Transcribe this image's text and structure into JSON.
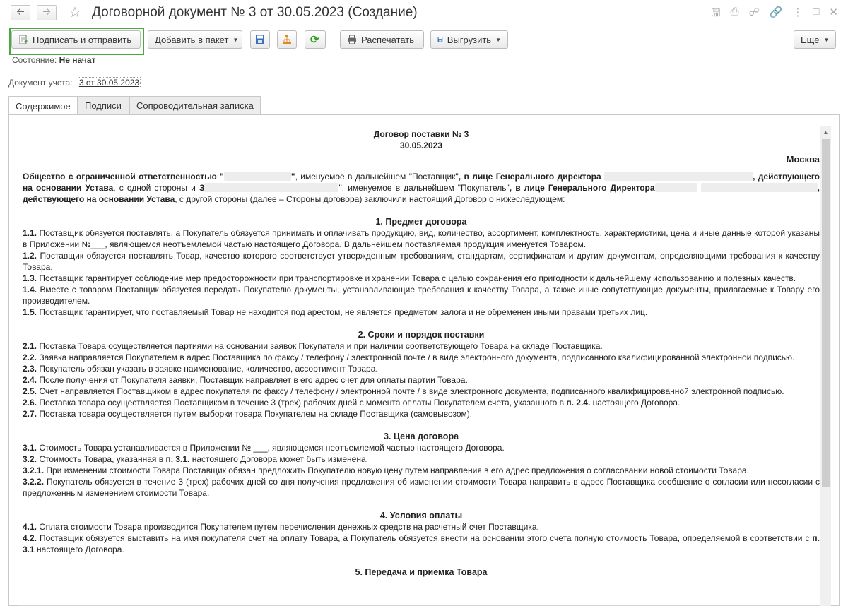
{
  "window": {
    "title": "Договорной документ № 3 от 30.05.2023 (Создание)"
  },
  "toolbar": {
    "sign_send": "Подписать и отправить",
    "add_package": "Добавить в пакет",
    "print": "Распечатать",
    "export": "Выгрузить",
    "more": "Еще"
  },
  "state": {
    "label": "Состояние:",
    "value": "Не начат"
  },
  "account": {
    "label": "Документ учета:",
    "value": "3 от 30.05.2023"
  },
  "tabs": [
    "Содержимое",
    "Подписи",
    "Сопроводительная записка"
  ],
  "document": {
    "title": "Договор поставки № 3",
    "date": "30.05.2023",
    "city": "Москва",
    "intro": {
      "p1": "Общество с ограниченной ответственностью \"",
      "p2": "\"",
      "p3": ", именуемое в дальнейшем \"Поставщик\"",
      "p4": ", в лице Генерального директора",
      "p5": ",",
      "p6": "действующего на основании Устава",
      "p7": ", с одной стороны и ",
      "p8": "З",
      "p9": "\", именуемое в дальнейшем \"Покупатель\"",
      "p10": ", в лице Генерального Директора",
      "p11": ", действующего на основании Устава",
      "p12": ", с другой стороны (далее – Стороны договора) заключили настоящий Договор о нижеследующем:"
    },
    "s1": {
      "title": "1. Предмет договора",
      "n1": "1.1.",
      "t1": " Поставщик обязуется поставлять, а Покупатель обязуется принимать и оплачивать продукцию, вид, количество, ассортимент, комплектность, характеристики, цена и иные данные которой указаны в Приложении №___, являющемся неотъемлемой частью настоящего Договора. В дальнейшем поставляемая продукция именуется Товаром.",
      "n2": "1.2.",
      "t2": " Поставщик обязуется поставлять Товар, качество которого соответствует утвержденным требованиям, стандартам, сертификатам и другим документам, определяющими требования к качеству Товара.",
      "n3": "1.3.",
      "t3": " Поставщик гарантирует соблюдение мер предосторожности при транспортировке и хранении Товара с целью сохранения его пригодности к дальнейшему использованию и полезных качеств.",
      "n4": "1.4.",
      "t4": " Вместе с товаром Поставщик обязуется передать Покупателю документы, устанавливающие требования к качеству Товара, а также иные сопутствующие документы, прилагаемые к Товару его производителем.",
      "n5": "1.5.",
      "t5": " Поставщик гарантирует, что поставляемый Товар не находится под арестом, не является предметом залога и не обременен иными правами третьих лиц."
    },
    "s2": {
      "title": "2. Сроки и порядок поставки",
      "n1": "2.1.",
      "t1": " Поставка Товара осуществляется партиями на основании заявок Покупателя и при наличии соответствующего Товара на складе Поставщика.",
      "n2": "2.2.",
      "t2": " Заявка направляется Покупателем в адрес Поставщика по факсу / телефону / электронной почте / в виде электронного документа, подписанного квалифицированной электронной подписью.",
      "n3": "2.3.",
      "t3": " Покупатель обязан указать в заявке наименование, количество, ассортимент Товара.",
      "n4": "2.4.",
      "t4": " После получения от Покупателя заявки, Поставщик направляет в его адрес счет для оплаты партии Товара.",
      "n5": "2.5.",
      "t5": " Счет направляется Поставщиком в адрес покупателя по факсу / телефону / электронной почте / в виде электронного документа, подписанного квалифицированной электронной подписью.",
      "n6": "2.6.",
      "t6a": " Поставка товара осуществляется Поставщиком в течение 3 (трех) рабочих дней с момента оплаты Покупателем счета, указанного в ",
      "t6b": "п. 2.4.",
      "t6c": " настоящего Договора.",
      "n7": "2.7.",
      "t7": " Поставка товара осуществляется путем выборки товара Покупателем на складе Поставщика (самовывозом)."
    },
    "s3": {
      "title": "3. Цена договора",
      "n1": "3.1.",
      "t1": " Стоимость Товара устанавливается в Приложении № ___, являющемся неотъемлемой частью настоящего Договора.",
      "n2": "3.2.",
      "t2a": " Стоимость Товара, указанная в ",
      "t2b": "п. 3.1.",
      "t2c": " настоящего Договора может быть изменена.",
      "n3": "3.2.1.",
      "t3": " При изменении стоимости Товара Поставщик обязан предложить Покупателю новую цену путем направления в его адрес предложения о согласовании новой стоимости Товара.",
      "n4": "3.2.2.",
      "t4": " Покупатель обязуется в течение 3 (трех) рабочих дней со дня получения предложения об изменении стоимости Товара направить в адрес Поставщика сообщение о согласии или несогласии с предложенным изменением стоимости Товара."
    },
    "s4": {
      "title": "4. Условия оплаты",
      "n1": "4.1.",
      "t1": " Оплата стоимости Товара производится Покупателем путем перечисления денежных средств на расчетный счет Поставщика.",
      "n2": "4.2.",
      "t2a": " Поставщик обязуется выставить на имя покупателя счет на оплату Товара, а Покупатель обязуется внести на основании этого счета полную стоимость Товара, определяемой в соответствии с ",
      "t2b": "п. 3.1",
      "t2c": " настоящего Договора."
    },
    "s5": {
      "title": "5. Передача и приемка Товара"
    }
  }
}
